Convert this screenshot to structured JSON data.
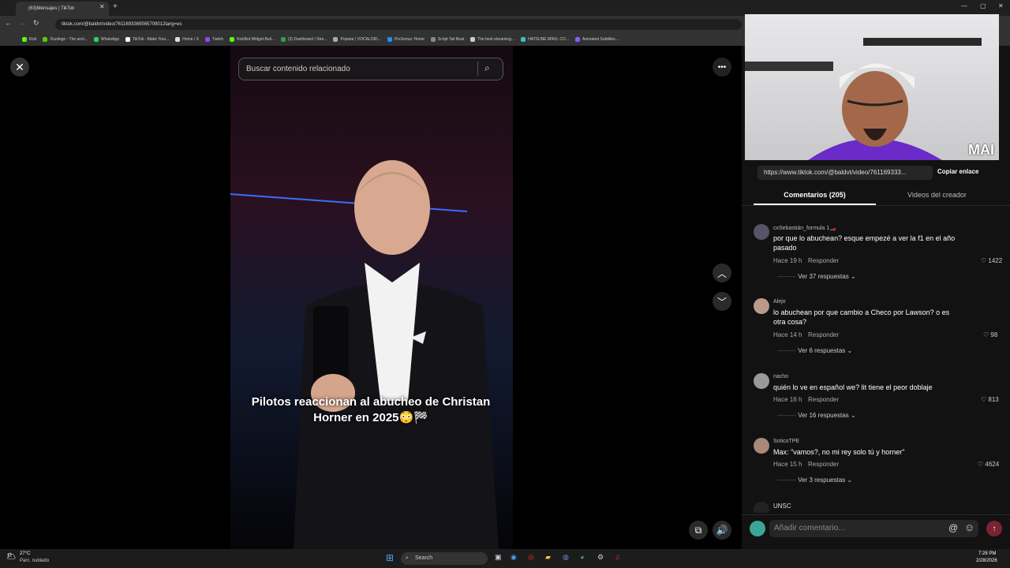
{
  "browser": {
    "tab_title": "(63)Mensajes | TikTok",
    "url": "tiktok.com/@baldvt/video/7611693369565709012lang=es",
    "bookmarks": [
      "Kick",
      "Duolingo - The worl...",
      "WhatsApp",
      "TikTok - Make Your...",
      "Home / X",
      "Twitch",
      "KickBot Widget Buil...",
      "(3) Dashboard / Stre...",
      "Popular | VOCALOID...",
      "PreSonus: Home",
      "Script Tail Beat",
      "The best streaming...",
      "HATSUNE MIKU: CO...",
      "Animated Subtitles..."
    ]
  },
  "search": {
    "placeholder": "Buscar contenido relacionado"
  },
  "video": {
    "caption": "Pilotos reaccionan al abucheo de Christan Horner en 2025😳🏁"
  },
  "webcam": {
    "overlay": "MAI"
  },
  "share": {
    "link": "https://www.tiktok.com/@baldvt/video/761169333...",
    "copy_label": "Copiar enlace"
  },
  "tabs": {
    "comments": "Comentarios (205)",
    "creator": "Videos del creador"
  },
  "comments": [
    {
      "user": "cxSebastián_formula 1🏎️",
      "text": "por que lo abuchean? esque empezé a ver la f1 en el año pasado",
      "time": "Hace 19 h",
      "reply": "Responder",
      "likes": "1422",
      "replies": "Ver 37 respuestas"
    },
    {
      "user": "Alejo",
      "text": "lo abuchean por que cambio a Checo por Lawson? o es otra cosa?",
      "time": "Hace 14 h",
      "reply": "Responder",
      "likes": "98",
      "replies": "Ver 6 respuestas"
    },
    {
      "user": "nacho",
      "text": "quién lo ve en español we? lit tiene el peor doblaje",
      "time": "Hace 16 h",
      "reply": "Responder",
      "likes": "813",
      "replies": "Ver 16 respuestas"
    },
    {
      "user": "SoticoTPE",
      "text": "Max: \"vamos?, no mi rey solo tú y horner\"",
      "time": "Hace 15 h",
      "reply": "Responder",
      "likes": "4624",
      "replies": "Ver 3 respuestas"
    },
    {
      "user": "UNSC",
      "text": "",
      "time": "",
      "reply": "",
      "likes": "",
      "replies": ""
    }
  ],
  "comment_input": {
    "placeholder": "Añadir comentario..."
  },
  "taskbar": {
    "weather_temp": "27°C",
    "weather_desc": "Parc. nublado",
    "search": "Search",
    "time": "7:28 PM",
    "date": "2/28/2026"
  }
}
